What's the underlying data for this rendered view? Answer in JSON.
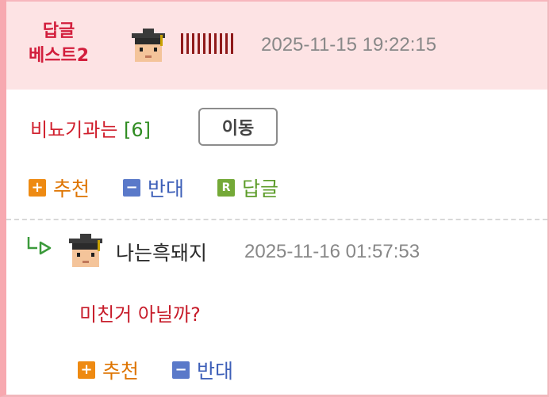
{
  "best_post": {
    "badge_line1": "답글",
    "badge_line2": "베스트2",
    "date": "2025-11-15 19:22:15",
    "title": "비뇨기과는",
    "comment_count": "[6]",
    "move_button": "이동",
    "actions": {
      "upvote": "추천",
      "downvote": "반대",
      "reply": "답글"
    }
  },
  "reply": {
    "nickname": "나는흑돼지",
    "date": "2025-11-16 01:57:53",
    "body": "미친거 아닐까?",
    "actions": {
      "upvote": "추천",
      "downvote": "반대"
    }
  },
  "icons": {
    "plus": "+",
    "minus": "−",
    "reply": "R"
  },
  "colors": {
    "best_bg": "#fde3e4",
    "title_red": "#d01f2d",
    "count_green": "#2f8c21",
    "upvote_orange": "#de7400",
    "downvote_blue": "#3d5fb8",
    "reply_green": "#5d9c2a"
  }
}
